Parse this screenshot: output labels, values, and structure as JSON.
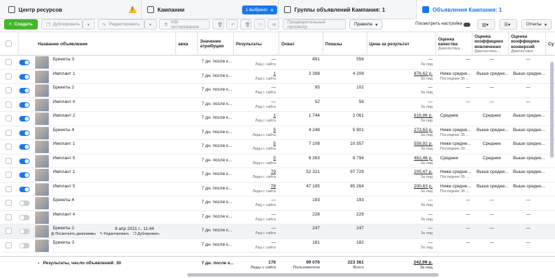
{
  "nav": {
    "resource_center": "Центр ресурсов",
    "campaigns": "Кампании",
    "selected_pill": "1 выбрано",
    "adsets": "Группы объявлений Кампания: 1",
    "ads": "Объявления Кампания: 1"
  },
  "toolbar": {
    "create": "Создать",
    "duplicate": "Дублировать",
    "edit": "Редактировать",
    "ab_test": "A/B-тестирование",
    "preview": "Предварительный просмотр",
    "rules": "Правила",
    "view_settings": "Посмотреть настройки",
    "reports": "Отчеты"
  },
  "columns": {
    "name": "Название объявления",
    "bid": "авка",
    "attribution": "Значение атрибуции",
    "results": "Результаты",
    "reach": "Охват",
    "impressions": "Показы",
    "cost_per_result": "Цена за результат",
    "quality": "Оценка качества",
    "quality_sub": "Диагностика ...",
    "engagement": "Оценка коэффициен вовлеченно",
    "engagement_sub": "Диагностика ...",
    "conversion": "Оценка коэффициен конверсий",
    "conversion_sub": "Диагностика",
    "extra": "Су"
  },
  "rows": [
    {
      "name": "Брекеты 3",
      "on": true,
      "attr": "7 дн. после к...",
      "res": "—",
      "res_sub": "Лид с сайта",
      "reach": "491",
      "impr": "556",
      "cost": "—",
      "cost_sub": "За лид",
      "q": "—",
      "e": "—",
      "c": "—"
    },
    {
      "name": "Имплант 1",
      "on": true,
      "attr": "7 дн. после к...",
      "res": "1",
      "res_sub": "Лид с сайта",
      "reach": "3 398",
      "impr": "4 208",
      "cost": "876,62 р.",
      "cost_sub": "За лид",
      "q": "Ниже средне...",
      "q_sub": "Последние 35 ...",
      "e": "Выше средне...",
      "c": "Выше средне..."
    },
    {
      "name": "Брекеты 2",
      "on": true,
      "attr": "7 дн. после к...",
      "res": "—",
      "res_sub": "Лид с сайта",
      "reach": "95",
      "impr": "102",
      "cost": "—",
      "cost_sub": "За лид",
      "q": "—",
      "e": "—",
      "c": "—"
    },
    {
      "name": "Имплант 4",
      "on": true,
      "attr": "7 дн. после к...",
      "res": "—",
      "res_sub": "Лид с сайта",
      "reach": "52",
      "impr": "56",
      "cost": "—",
      "cost_sub": "За лид",
      "q": "—",
      "e": "—",
      "c": "—"
    },
    {
      "name": "Имплант 2",
      "on": true,
      "attr": "7 дн. после к...",
      "res": "1",
      "res_sub": "Лид с сайта",
      "reach": "1 744",
      "impr": "2 061",
      "cost": "616,86 р.",
      "cost_sub": "За лид",
      "q": "Среднее",
      "e": "Среднее",
      "c": "Выше средне..."
    },
    {
      "name": "Брекеты 4",
      "on": true,
      "attr": "7 дн. после к...",
      "res": "5",
      "res_sub": "Лиды с сайта",
      "reach": "4 248",
      "impr": "5 901",
      "cost": "273,63 р.",
      "cost_sub": "За лид",
      "q": "Ниже средне...",
      "q_sub": "Последние 35 ...",
      "e": "Выше средне...",
      "c": "Выше средне..."
    },
    {
      "name": "Имплант 1",
      "on": true,
      "attr": "7 дн. после к...",
      "res": "5",
      "res_sub": "Лиды с сайта",
      "reach": "7 108",
      "impr": "10 357",
      "cost": "558,92 р.",
      "cost_sub": "За лид",
      "q": "Ниже средне...",
      "q_sub": "Последние 20 ...",
      "e": "Среднее",
      "c": "Выше средне..."
    },
    {
      "name": "Имплант 5",
      "on": true,
      "attr": "7 дн. после к...",
      "res": "5",
      "res_sub": "Лиды с сайта",
      "reach": "6 263",
      "impr": "8 794",
      "cost": "461,46 р.",
      "cost_sub": "За лид",
      "q": "Среднее",
      "e": "Среднее",
      "c": "Выше средне..."
    },
    {
      "name": "Имплант 1",
      "on": true,
      "attr": "7 дн. после к...",
      "res": "79",
      "res_sub": "Лиды с сайта",
      "reach": "52 321",
      "impr": "97 729",
      "cost": "205,47 р.",
      "cost_sub": "За лид",
      "q": "Ниже средне...",
      "q_sub": "Последние 35 ...",
      "e": "Выше средне...",
      "c": "Выше средне..."
    },
    {
      "name": "Имплант 5",
      "on": true,
      "attr": "7 дн. после к...",
      "res": "78",
      "res_sub": "Лиды с сайта",
      "reach": "47 195",
      "impr": "85 264",
      "cost": "200,63 р.",
      "cost_sub": "За лид",
      "q": "Ниже средне...",
      "q_sub": "Последние 35 ...",
      "e": "Выше средне...",
      "c": "Выше средне..."
    },
    {
      "name": "Брекеты 4",
      "on": false,
      "attr": "7 дн. после к...",
      "res": "—",
      "res_sub": "Лид с сайта",
      "reach": "193",
      "impr": "193",
      "cost": "—",
      "cost_sub": "За лид",
      "q": "—",
      "e": "—",
      "c": "—"
    },
    {
      "name": "Имплант 4",
      "on": false,
      "attr": "7 дн. после к...",
      "res": "—",
      "res_sub": "Лид с сайта",
      "reach": "228",
      "impr": "229",
      "cost": "—",
      "cost_sub": "За лид",
      "q": "—",
      "e": "—",
      "c": "—"
    },
    {
      "name": "Брекеты 2",
      "on": false,
      "attr": "7 дн. после к...",
      "res": "—",
      "res_sub": "Лид с сайта",
      "reach": "247",
      "impr": "247",
      "cost": "—",
      "cost_sub": "За лид",
      "q": "—",
      "e": "—",
      "c": "—",
      "hover": true
    },
    {
      "name": "Брекеты 3",
      "on": false,
      "attr": "7 дн. после к...",
      "res": "—",
      "res_sub": "Лид с сайта",
      "reach": "181",
      "impr": "182",
      "cost": "—",
      "cost_sub": "За лид",
      "q": "—",
      "e": "—",
      "c": "—"
    }
  ],
  "hover_row": {
    "date": "9 апр 2021 г., 11:44",
    "view_charts": "Посмотреть диаграммы",
    "edit": "Редактировать",
    "duplicate": "Дублировать"
  },
  "footer": {
    "label": "Результаты, число объявлений: 30",
    "attr": "7 дн. после к...",
    "res": "176",
    "res_sub": "Лиды с сайта",
    "reach": "99 076",
    "reach_sub": "Пользователи",
    "impr": "223 361",
    "impr_sub": "Всего",
    "cost": "242,99 р.",
    "cost_sub": "За лид"
  },
  "colors": {
    "accent": "#1877f2",
    "create": "#42b72a",
    "warning": "#f7b928"
  }
}
